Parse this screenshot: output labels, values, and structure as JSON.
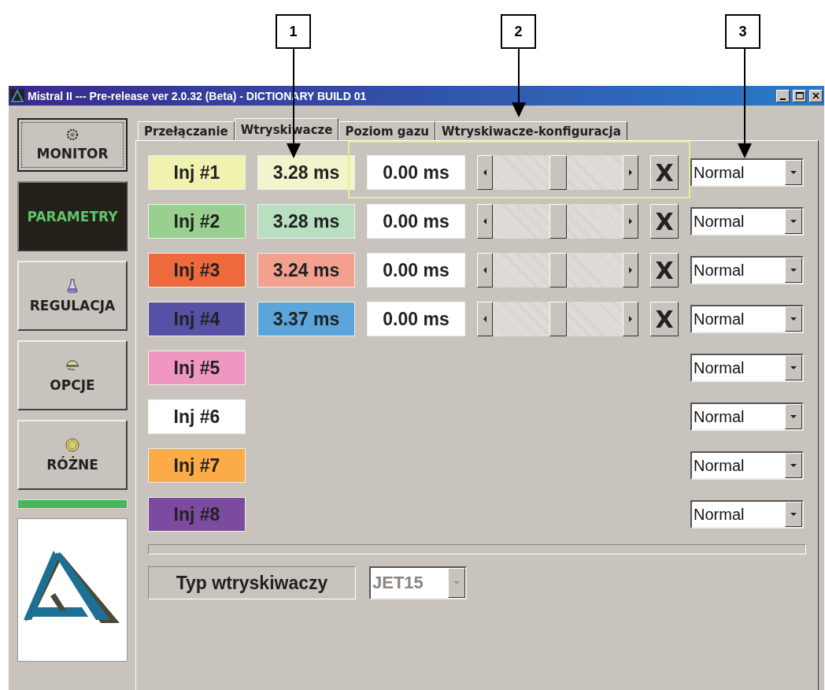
{
  "callouts": [
    {
      "label": "1"
    },
    {
      "label": "2"
    },
    {
      "label": "3"
    }
  ],
  "window": {
    "title": "Mistral II --- Pre-release ver 2.0.32 (Beta) - DICTIONARY BUILD 01"
  },
  "sidebar": {
    "items": [
      {
        "label": "MONITOR",
        "selected": false,
        "focused": true
      },
      {
        "label": "PARAMETRY",
        "selected": true,
        "focused": false
      },
      {
        "label": "REGULACJA",
        "selected": false,
        "focused": false
      },
      {
        "label": "OPCJE",
        "selected": false,
        "focused": false
      },
      {
        "label": "RÓŻNE",
        "selected": false,
        "focused": false
      }
    ]
  },
  "tabs": [
    {
      "label": "Przełączanie",
      "selected": false
    },
    {
      "label": "Wtryskiwacze",
      "selected": true
    },
    {
      "label": "Poziom gazu",
      "selected": false
    },
    {
      "label": "Wtryskiwacze-konfiguracja",
      "selected": false
    }
  ],
  "injectors": [
    {
      "label": "Inj #1",
      "color": "#f0f2b0",
      "measured": {
        "text": "3.28 ms",
        "color": "#f2f5cc"
      },
      "correction": "0.00 ms",
      "reset": "X",
      "mode": "Normal"
    },
    {
      "label": "Inj #2",
      "color": "#99cf8f",
      "measured": {
        "text": "3.28 ms",
        "color": "#b8dfbf"
      },
      "correction": "0.00 ms",
      "reset": "X",
      "mode": "Normal"
    },
    {
      "label": "Inj #3",
      "color": "#ee6a3c",
      "measured": {
        "text": "3.24 ms",
        "color": "#f4a08f"
      },
      "correction": "0.00 ms",
      "reset": "X",
      "mode": "Normal"
    },
    {
      "label": "Inj #4",
      "color": "#5651a5",
      "measured": {
        "text": "3.37 ms",
        "color": "#5ba5dc"
      },
      "correction": "0.00 ms",
      "reset": "X",
      "mode": "Normal"
    },
    {
      "label": "Inj #5",
      "color": "#ef97c1",
      "mode": "Normal"
    },
    {
      "label": "Inj #6",
      "color": "#ffffff",
      "mode": "Normal"
    },
    {
      "label": "Inj #7",
      "color": "#fbab47",
      "mode": "Normal"
    },
    {
      "label": "Inj #8",
      "color": "#7c4a9f",
      "mode": "Normal"
    }
  ],
  "injector_type": {
    "label": "Typ wtryskiwaczy",
    "value": "JET15",
    "disabled": true
  }
}
